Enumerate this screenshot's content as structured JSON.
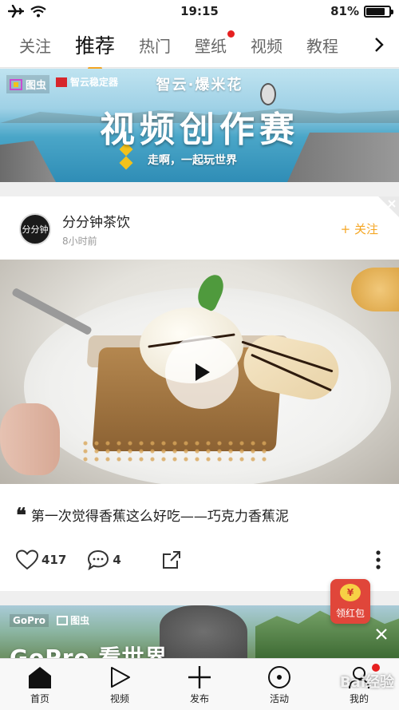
{
  "status_bar": {
    "time": "19:15",
    "battery": "81%",
    "battery_level": 0.81
  },
  "tabs": [
    {
      "label": "关注"
    },
    {
      "label": "推荐",
      "active": true
    },
    {
      "label": "热门"
    },
    {
      "label": "壁纸",
      "badge": true
    },
    {
      "label": "视频"
    },
    {
      "label": "教程"
    },
    {
      "label": "i"
    }
  ],
  "banner": {
    "logo1": "图虫",
    "logo2": "智云稳定器",
    "subtitle": "智云·爆米花",
    "title": "视频创作赛",
    "tagline": "走啊，一起玩世界"
  },
  "post": {
    "author": "分分钟茶饮",
    "avatar_text": "分分钟",
    "time": "8小时前",
    "follow_label": "+ 关注",
    "title": "第一次觉得香蕉这么好吃——巧克力香蕉泥",
    "likes": "417",
    "comments": "4"
  },
  "red_packet": {
    "label": "领红包",
    "coin": "¥"
  },
  "post2": {
    "logo1": "GoPro",
    "logo2": "图虫",
    "title": "GoPro 看世界"
  },
  "bottom_nav": [
    {
      "label": "首页"
    },
    {
      "label": "视频"
    },
    {
      "label": "发布"
    },
    {
      "label": "活动"
    },
    {
      "label": "我的",
      "badge": true
    }
  ],
  "watermark": "Bai经验"
}
